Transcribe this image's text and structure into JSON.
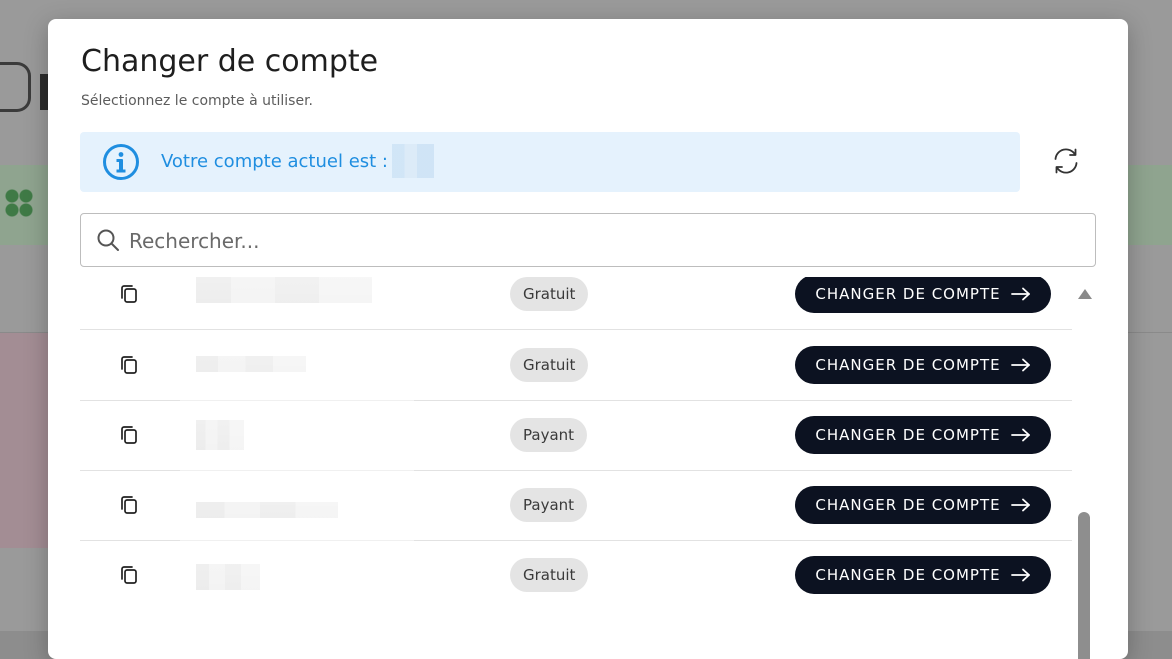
{
  "modal": {
    "title": "Changer de compte",
    "subtitle": "Sélectionnez le compte à utiliser."
  },
  "banner": {
    "text": "Votre compte actuel est :",
    "icon": "info-icon",
    "color": "#1f8ee0",
    "background": "#e5f2fd"
  },
  "toolbar": {
    "refresh_icon": "refresh-icon"
  },
  "search": {
    "placeholder": "Rechercher...",
    "value": ""
  },
  "accounts": [
    {
      "plan": "Gratuit",
      "action": "CHANGER DE COMPTE"
    },
    {
      "plan": "Gratuit",
      "action": "CHANGER DE COMPTE"
    },
    {
      "plan": "Payant",
      "action": "CHANGER DE COMPTE"
    },
    {
      "plan": "Payant",
      "action": "CHANGER DE COMPTE"
    },
    {
      "plan": "Gratuit",
      "action": "CHANGER DE COMPTE"
    }
  ],
  "colors": {
    "button_bg": "#0c1221",
    "badge_bg": "#e4e4e4"
  },
  "scroll": {
    "position": "bottom"
  }
}
